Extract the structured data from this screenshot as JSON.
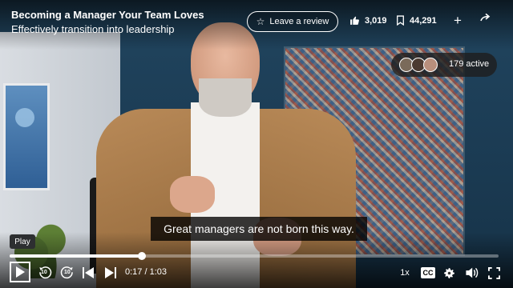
{
  "header": {
    "course_title": "Becoming a Manager Your Team Loves",
    "course_subtitle": "Effectively transition into leadership",
    "review_label": "Leave a review",
    "likes": "3,019",
    "saves": "44,291",
    "icons": {
      "review": "star-icon",
      "likes": "thumbs-up-icon",
      "saves": "bookmark-icon",
      "add": "plus-icon",
      "share": "share-arrow-icon"
    }
  },
  "viewers": {
    "active_label": "179 active"
  },
  "caption": {
    "text": "Great managers are not born this way."
  },
  "player": {
    "tooltip": "Play",
    "current_time": "0:17",
    "duration": "1:03",
    "time_display": "0:17 / 1:03",
    "progress_fraction": 0.27,
    "speed": "1x",
    "cc_label": "CC",
    "rewind_seconds": "10",
    "forward_seconds": "10"
  }
}
